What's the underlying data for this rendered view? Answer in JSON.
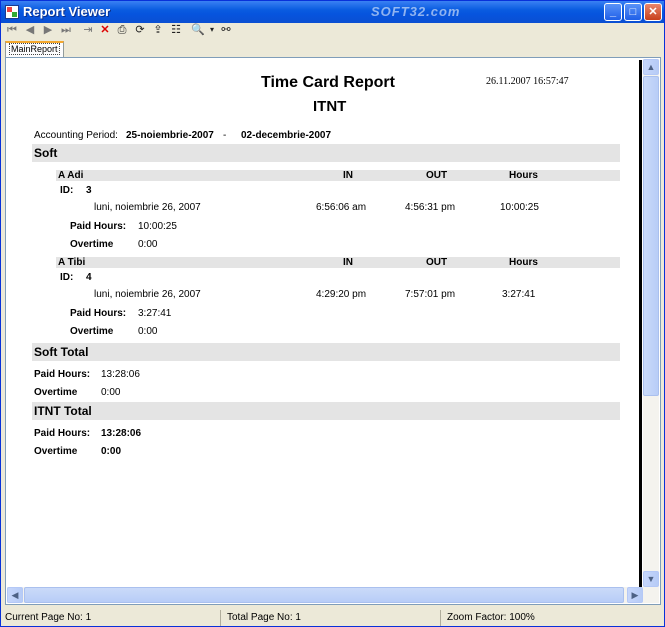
{
  "window": {
    "title": "Report Viewer",
    "watermark": "SOFT32.com"
  },
  "tab": {
    "label": "MainReport"
  },
  "report": {
    "title": "Time Card Report",
    "timestamp": "26.11.2007 16:57:47",
    "company": "ITNT",
    "period_label": "Accounting Period:",
    "period_start": "25-noiembrie-2007",
    "period_sep": "-",
    "period_end": "02-decembrie-2007",
    "group": "Soft",
    "col_in": "IN",
    "col_out": "OUT",
    "col_hours": "Hours",
    "id_label": "ID:",
    "paid_label": "Paid Hours:",
    "overtime_label": "Overtime",
    "employees": [
      {
        "name": "A Adi",
        "id": "3",
        "date": "luni, noiembrie 26, 2007",
        "in": "6:56:06 am",
        "out": "4:56:31 pm",
        "hours": "10:00:25",
        "paid": "10:00:25",
        "overtime": "0:00"
      },
      {
        "name": "A Tibi",
        "id": "4",
        "date": "luni, noiembrie 26, 2007",
        "in": "4:29:20 pm",
        "out": "7:57:01 pm",
        "hours": "3:27:41",
        "paid": "3:27:41",
        "overtime": "0:00"
      }
    ],
    "group_total_label": "Soft Total",
    "group_total_paid": "13:28:06",
    "group_total_overtime": "0:00",
    "company_total_label": "ITNT Total",
    "company_total_paid": "13:28:06",
    "company_total_overtime": "0:00"
  },
  "status": {
    "current_page": "Current Page No: 1",
    "total_page": "Total Page No: 1",
    "zoom": "Zoom Factor: 100%"
  }
}
